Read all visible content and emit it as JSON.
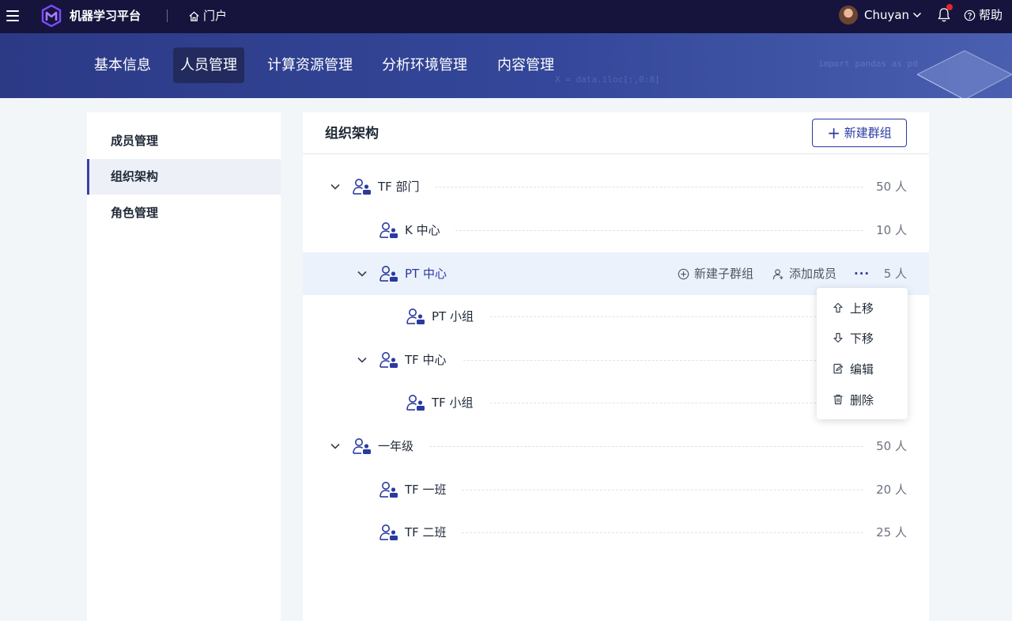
{
  "topbar": {
    "app_title": "机器学习平台",
    "portal_label": "门户",
    "user_name": "Chuyan",
    "help_label": "帮助",
    "icons": [
      "menu-icon",
      "logo-icon",
      "home-icon",
      "chevron-down-icon",
      "bell-icon",
      "help-icon"
    ]
  },
  "banner": {
    "tabs": [
      {
        "label": "基本信息",
        "active": false
      },
      {
        "label": "人员管理",
        "active": true
      },
      {
        "label": "计算资源管理",
        "active": false
      },
      {
        "label": "分析环境管理",
        "active": false
      },
      {
        "label": "内容管理",
        "active": false
      }
    ],
    "code_text_1": "import pandas as pd",
    "code_text_2": "X = data.iloc[:,0:8]"
  },
  "sidebar": {
    "items": [
      {
        "label": "成员管理",
        "active": false
      },
      {
        "label": "组织架构",
        "active": true
      },
      {
        "label": "角色管理",
        "active": false
      }
    ]
  },
  "main": {
    "title": "组织架构",
    "new_group_button": "新建群组",
    "tree": [
      {
        "name": "TF 部门",
        "count": "50 人",
        "expanded": true
      },
      {
        "name": "K 中心",
        "count": "10 人"
      },
      {
        "name": "PT 中心",
        "count": "5 人",
        "expanded": true,
        "selected": true
      },
      {
        "name": "PT 小组",
        "count": ""
      },
      {
        "name": "TF 中心",
        "count": "",
        "expanded": true
      },
      {
        "name": "TF 小组",
        "count": ""
      },
      {
        "name": "一年级",
        "count": "50 人",
        "expanded": true
      },
      {
        "name": "TF 一班",
        "count": "20 人"
      },
      {
        "name": "TF 二班",
        "count": "25 人"
      }
    ],
    "row_actions": {
      "new_subgroup": "新建子群组",
      "add_member": "添加成员",
      "more": "···"
    }
  },
  "dropdown": {
    "items": [
      {
        "label": "上移",
        "icon": "arrow-up-icon"
      },
      {
        "label": "下移",
        "icon": "arrow-down-icon"
      },
      {
        "label": "编辑",
        "icon": "edit-icon"
      },
      {
        "label": "删除",
        "icon": "trash-icon"
      }
    ]
  },
  "colors": {
    "topbar_bg": "#16143d",
    "banner_bg": "#2c3a86",
    "accent": "#2a3aa0",
    "selected_row_bg": "#ecf2fc",
    "notification_dot": "#e1262c"
  }
}
